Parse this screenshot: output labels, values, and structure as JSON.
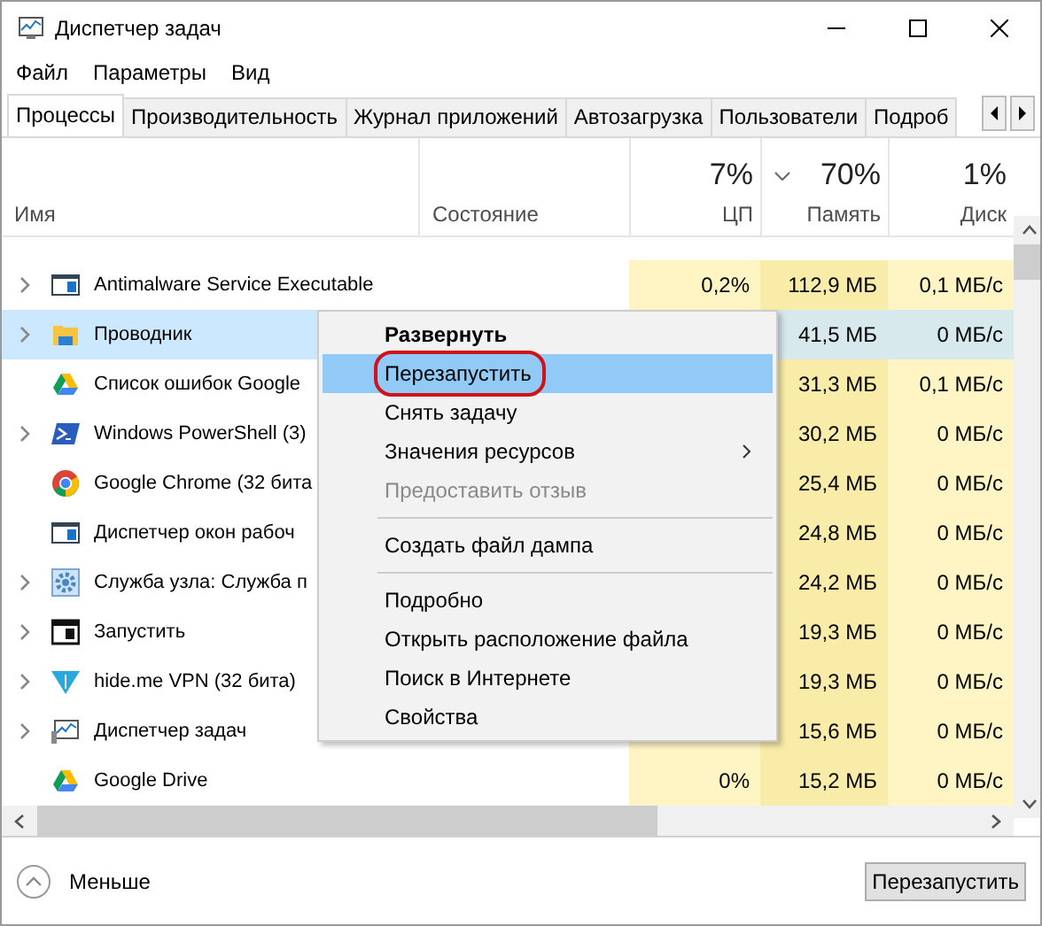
{
  "window": {
    "title": "Диспетчер задач"
  },
  "menu": [
    "Файл",
    "Параметры",
    "Вид"
  ],
  "tabs": [
    {
      "label": "Процессы",
      "selected": true
    },
    {
      "label": "Производительность",
      "selected": false
    },
    {
      "label": "Журнал приложений",
      "selected": false
    },
    {
      "label": "Автозагрузка",
      "selected": false
    },
    {
      "label": "Пользователи",
      "selected": false
    },
    {
      "label": "Подроб",
      "selected": false
    }
  ],
  "columns": [
    {
      "label": "Имя",
      "sorted": false
    },
    {
      "label": "Состояние",
      "sorted": false
    },
    {
      "label": "ЦП",
      "total": "7%",
      "sorted": false
    },
    {
      "label": "Память",
      "total": "70%",
      "sorted": true
    },
    {
      "label": "Диск",
      "total": "1%",
      "sorted": false
    }
  ],
  "rows": [
    {
      "name": "Antimalware Service Executable",
      "kind": "window",
      "expandable": true,
      "selected": false,
      "cpu": "0,2%",
      "memory": "112,9 МБ",
      "disk": "0,1 МБ/с"
    },
    {
      "name": "Проводник",
      "kind": "folder",
      "expandable": true,
      "selected": true,
      "memory": "41,5 МБ",
      "disk": "0 МБ/с"
    },
    {
      "name": "Список ошибок Google",
      "kind": "drive",
      "expandable": false,
      "selected": false,
      "memory": "31,3 МБ",
      "disk": "0,1 МБ/с"
    },
    {
      "name": "Windows PowerShell (3)",
      "kind": "shell",
      "expandable": true,
      "selected": false,
      "memory": "30,2 МБ",
      "disk": "0 МБ/с"
    },
    {
      "name": "Google Chrome (32 бита",
      "kind": "chrome",
      "expandable": false,
      "selected": false,
      "memory": "25,4 МБ",
      "disk": "0 МБ/с"
    },
    {
      "name": "Диспетчер окон рабоч",
      "kind": "window",
      "expandable": false,
      "selected": false,
      "memory": "24,8 МБ",
      "disk": "0 МБ/с"
    },
    {
      "name": "Служба узла: Служба п",
      "kind": "gear",
      "expandable": true,
      "selected": false,
      "memory": "24,2 МБ",
      "disk": "0 МБ/с"
    },
    {
      "name": "Запустить",
      "kind": "run",
      "expandable": true,
      "selected": false,
      "memory": "19,3 МБ",
      "disk": "0 МБ/с"
    },
    {
      "name": "hide.me VPN (32 бита)",
      "kind": "vpn",
      "expandable": true,
      "selected": false,
      "memory": "19,3 МБ",
      "disk": "0 МБ/с"
    },
    {
      "name": "Диспетчер задач",
      "kind": "monitor",
      "expandable": true,
      "selected": false,
      "memory": "15,6 МБ",
      "disk": "0 МБ/с"
    },
    {
      "name": "Google Drive",
      "kind": "drive",
      "expandable": false,
      "selected": false,
      "cpu": "0%",
      "memory": "15,2 МБ",
      "disk": "0 МБ/с"
    }
  ],
  "context_menu": [
    {
      "kind": "item",
      "label": "Развернуть",
      "bold": true,
      "selected": false,
      "disabled": false
    },
    {
      "kind": "item",
      "label": "Перезапустить",
      "bold": false,
      "selected": true,
      "disabled": false,
      "circled": true
    },
    {
      "kind": "item",
      "label": "Снять задачу",
      "bold": false,
      "selected": false,
      "disabled": false
    },
    {
      "kind": "item",
      "label": "Значения ресурсов",
      "bold": false,
      "selected": false,
      "disabled": false,
      "submenu": true
    },
    {
      "kind": "item",
      "label": "Предоставить отзыв",
      "bold": false,
      "selected": false,
      "disabled": true
    },
    {
      "kind": "separator"
    },
    {
      "kind": "item",
      "label": "Создать файл дампа",
      "bold": false,
      "selected": false,
      "disabled": false
    },
    {
      "kind": "separator"
    },
    {
      "kind": "item",
      "label": "Подробно",
      "bold": false,
      "selected": false,
      "disabled": false
    },
    {
      "kind": "item",
      "label": "Открыть расположение файла",
      "bold": false,
      "selected": false,
      "disabled": false
    },
    {
      "kind": "item",
      "label": "Поиск в Интернете",
      "bold": false,
      "selected": false,
      "disabled": false
    },
    {
      "kind": "item",
      "label": "Свойства",
      "bold": false,
      "selected": false,
      "disabled": false
    }
  ],
  "footer": {
    "toggle": "Меньше",
    "button": "Перезапустить"
  }
}
